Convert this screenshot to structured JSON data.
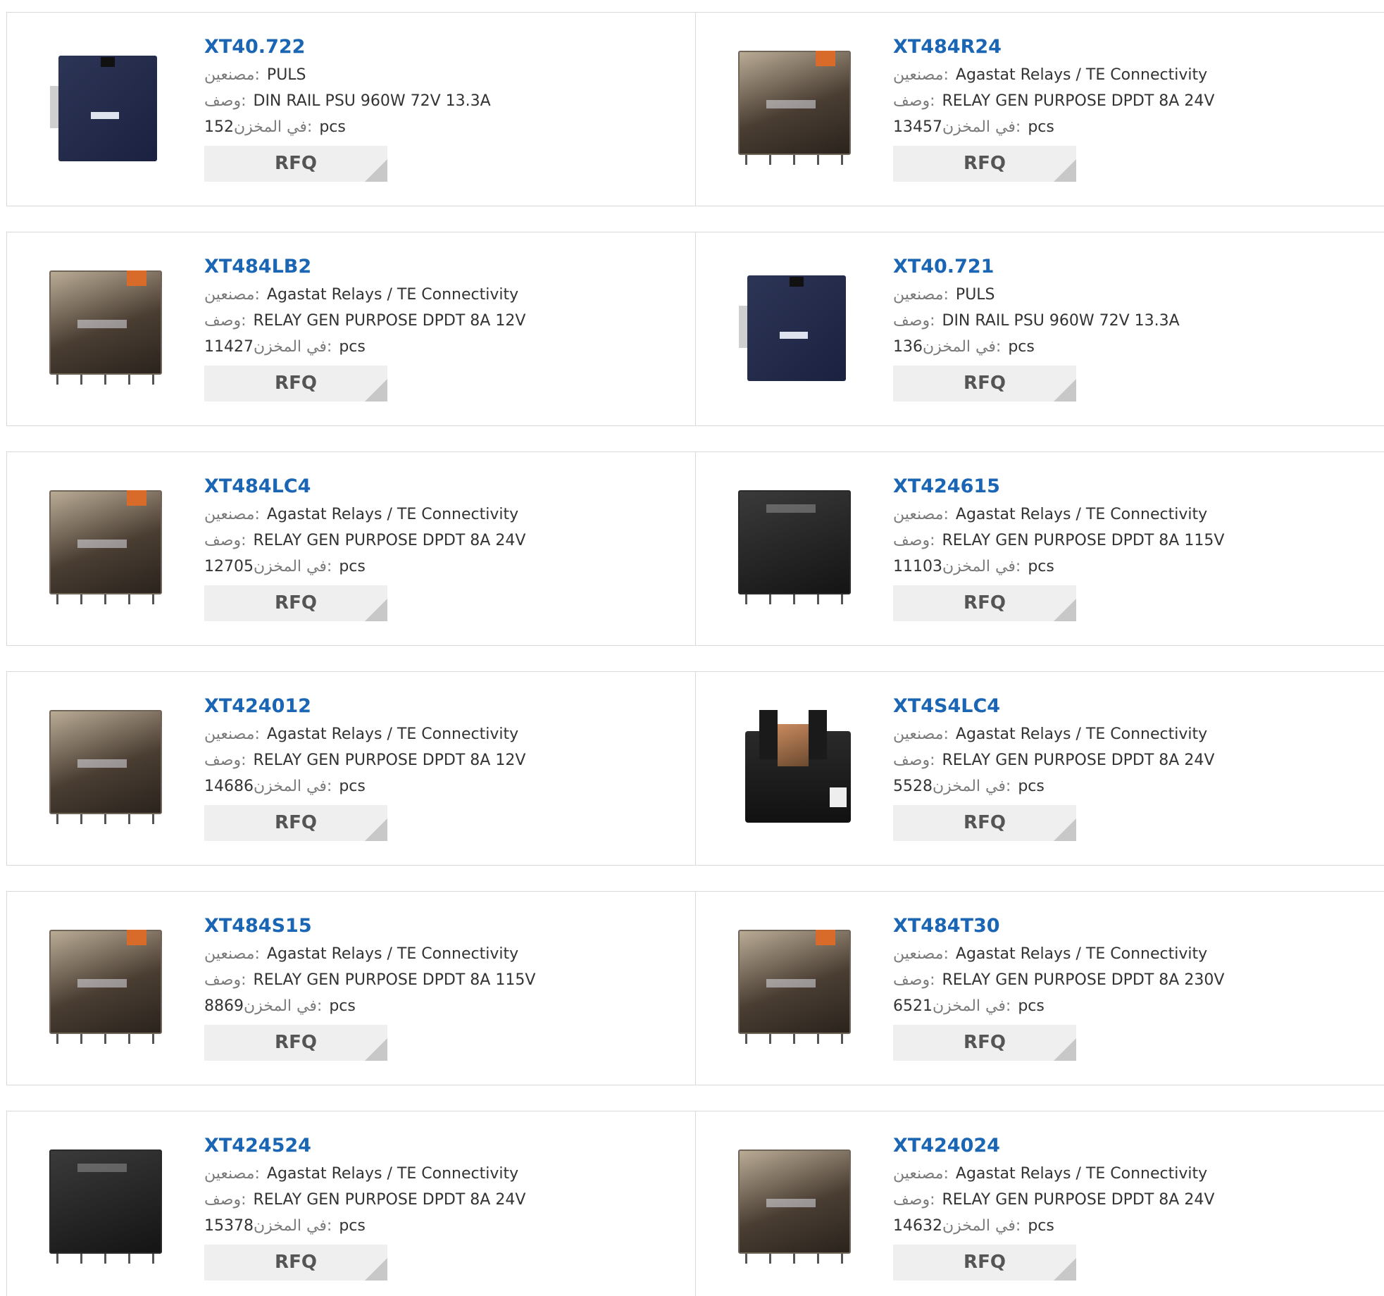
{
  "labels": {
    "manufacturer": "مصنعين:",
    "description": "وصف:",
    "stock": "في المخزن:",
    "unit": "pcs",
    "rfq": "RFQ"
  },
  "products": [
    {
      "part": "XT40.722",
      "manufacturer": "PULS",
      "description": "DIN RAIL PSU 960W 72V 13.3A",
      "stock": "152",
      "image_icon": "power-supply-icon"
    },
    {
      "part": "XT484R24",
      "manufacturer": "Agastat Relays / TE Connectivity",
      "description": "RELAY GEN PURPOSE DPDT 8A 24V",
      "stock": "13457",
      "image_icon": "relay-icon"
    },
    {
      "part": "XT484LB2",
      "manufacturer": "Agastat Relays / TE Connectivity",
      "description": "RELAY GEN PURPOSE DPDT 8A 12V",
      "stock": "11427",
      "image_icon": "relay-icon"
    },
    {
      "part": "XT40.721",
      "manufacturer": "PULS",
      "description": "DIN RAIL PSU 960W 72V 13.3A",
      "stock": "136",
      "image_icon": "power-supply-icon"
    },
    {
      "part": "XT484LC4",
      "manufacturer": "Agastat Relays / TE Connectivity",
      "description": "RELAY GEN PURPOSE DPDT 8A 24V",
      "stock": "12705",
      "image_icon": "relay-icon"
    },
    {
      "part": "XT424615",
      "manufacturer": "Agastat Relays / TE Connectivity",
      "description": "RELAY GEN PURPOSE DPDT 8A 115V",
      "stock": "11103",
      "image_icon": "relay-dark-icon"
    },
    {
      "part": "XT424012",
      "manufacturer": "Agastat Relays / TE Connectivity",
      "description": "RELAY GEN PURPOSE DPDT 8A 12V",
      "stock": "14686",
      "image_icon": "relay-icon"
    },
    {
      "part": "XT4S4LC4",
      "manufacturer": "Agastat Relays / TE Connectivity",
      "description": "RELAY GEN PURPOSE DPDT 8A 24V",
      "stock": "5528",
      "image_icon": "relay-socket-icon"
    },
    {
      "part": "XT484S15",
      "manufacturer": "Agastat Relays / TE Connectivity",
      "description": "RELAY GEN PURPOSE DPDT 8A 115V",
      "stock": "8869",
      "image_icon": "relay-icon"
    },
    {
      "part": "XT484T30",
      "manufacturer": "Agastat Relays / TE Connectivity",
      "description": "RELAY GEN PURPOSE DPDT 8A 230V",
      "stock": "6521",
      "image_icon": "relay-icon"
    },
    {
      "part": "XT424524",
      "manufacturer": "Agastat Relays / TE Connectivity",
      "description": "RELAY GEN PURPOSE DPDT 8A 24V",
      "stock": "15378",
      "image_icon": "relay-dark-icon"
    },
    {
      "part": "XT424024",
      "manufacturer": "Agastat Relays / TE Connectivity",
      "description": "RELAY GEN PURPOSE DPDT 8A 24V",
      "stock": "14632",
      "image_icon": "relay-icon"
    }
  ],
  "colors": {
    "part_link": "#1a66b5",
    "rfq_bg": "#efefef",
    "border": "#d9d9d9"
  }
}
